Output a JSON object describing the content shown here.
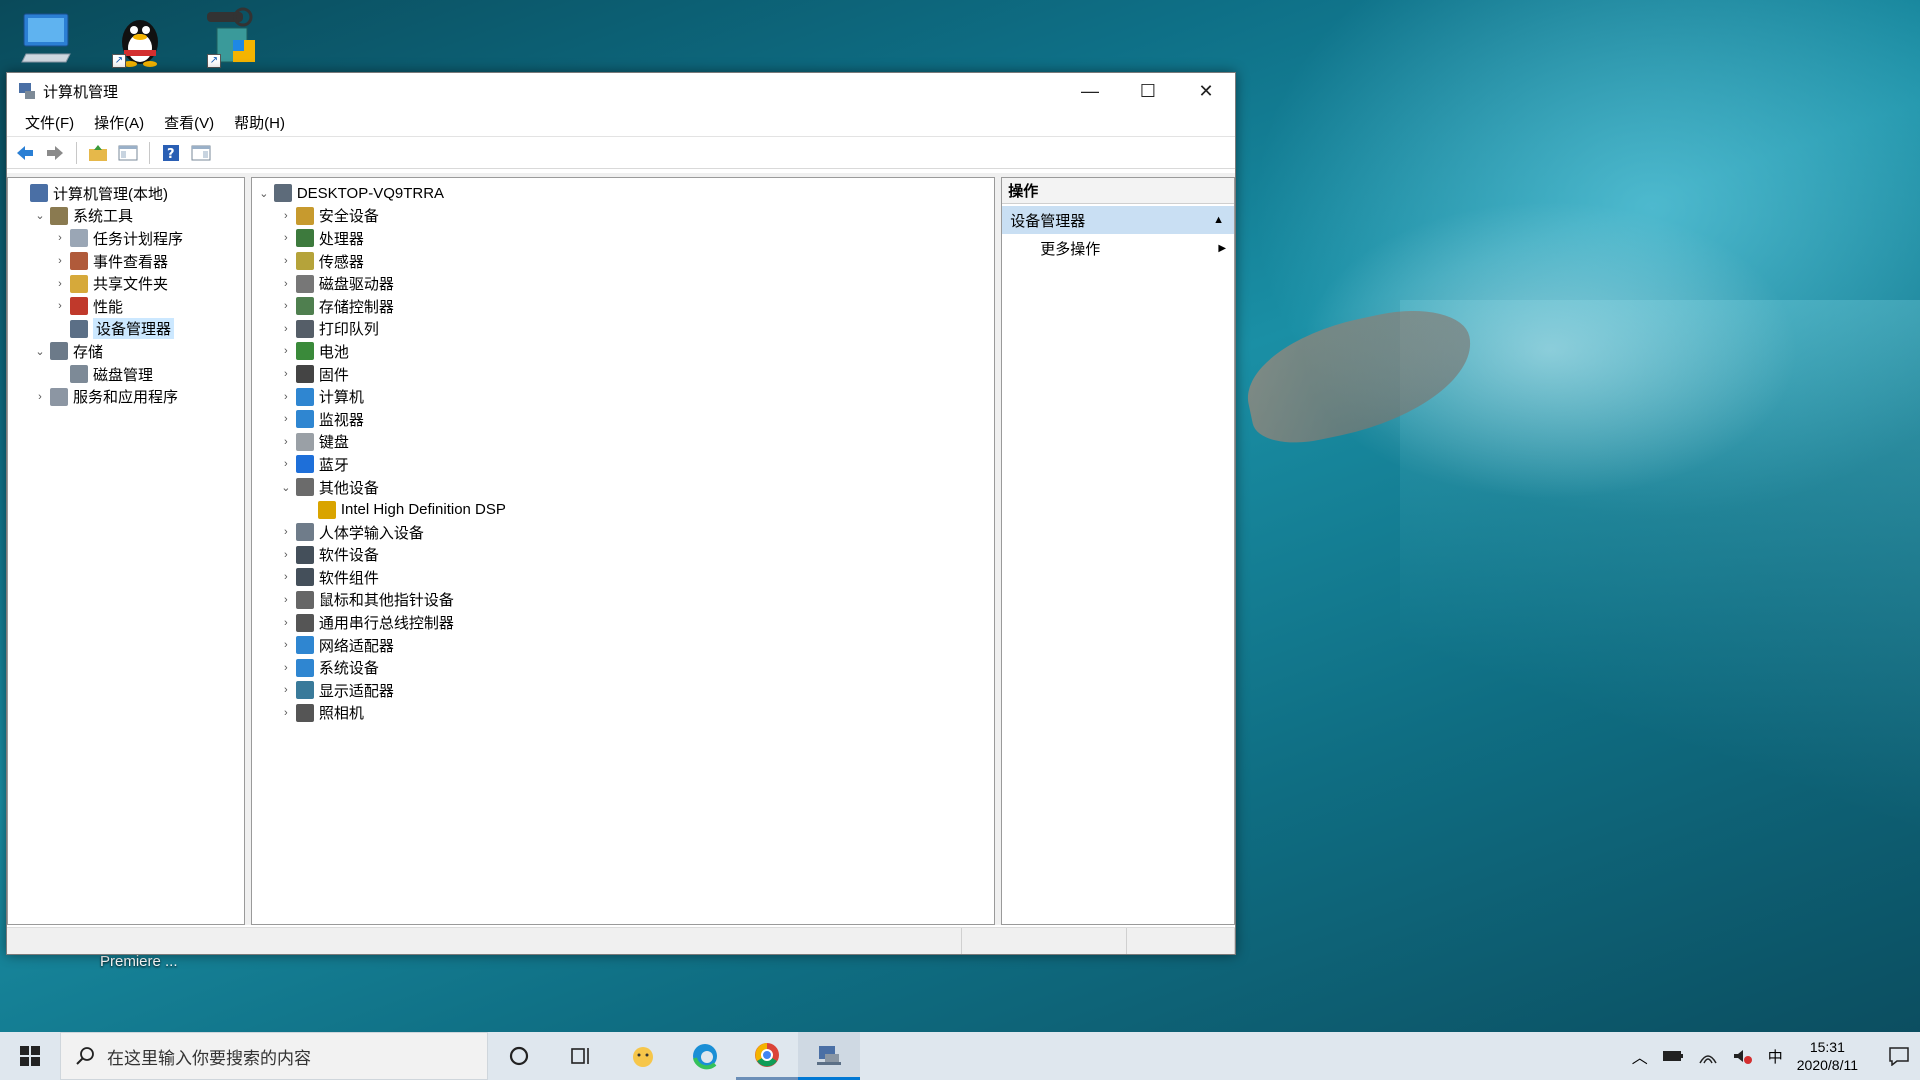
{
  "window": {
    "title": "计算机管理",
    "minimize": "—",
    "maximize": "☐",
    "close": "✕"
  },
  "menu": [
    "文件(F)",
    "操作(A)",
    "查看(V)",
    "帮助(H)"
  ],
  "left_tree": [
    {
      "label": "计算机管理(本地)",
      "level": 0,
      "twisty": "",
      "icon": "computer-management-icon",
      "color": "#4a6fa5"
    },
    {
      "label": "系统工具",
      "level": 1,
      "twisty": "⌄",
      "icon": "tools-icon",
      "color": "#8a7a50"
    },
    {
      "label": "任务计划程序",
      "level": 2,
      "twisty": "›",
      "icon": "clock-icon",
      "color": "#9aa6b5"
    },
    {
      "label": "事件查看器",
      "level": 2,
      "twisty": "›",
      "icon": "event-viewer-icon",
      "color": "#b05a3a"
    },
    {
      "label": "共享文件夹",
      "level": 2,
      "twisty": "›",
      "icon": "shared-folder-icon",
      "color": "#d6a93a"
    },
    {
      "label": "性能",
      "level": 2,
      "twisty": "›",
      "icon": "performance-icon",
      "color": "#c0392b"
    },
    {
      "label": "设备管理器",
      "level": 2,
      "twisty": "",
      "icon": "device-manager-icon",
      "color": "#5b6f86",
      "selected": true
    },
    {
      "label": "存储",
      "level": 1,
      "twisty": "⌄",
      "icon": "storage-icon",
      "color": "#6c7a89"
    },
    {
      "label": "磁盘管理",
      "level": 2,
      "twisty": "",
      "icon": "disk-icon",
      "color": "#7d8a97"
    },
    {
      "label": "服务和应用程序",
      "level": 1,
      "twisty": "›",
      "icon": "services-icon",
      "color": "#8c96a3"
    }
  ],
  "device_tree": [
    {
      "label": "DESKTOP-VQ9TRRA",
      "level": 0,
      "twisty": "⌄",
      "icon": "computer-icon",
      "color": "#5d6b7a"
    },
    {
      "label": "安全设备",
      "level": 1,
      "twisty": "›",
      "icon": "security-device-icon",
      "color": "#c79a2e"
    },
    {
      "label": "处理器",
      "level": 1,
      "twisty": "›",
      "icon": "processor-icon",
      "color": "#3d7a3d"
    },
    {
      "label": "传感器",
      "level": 1,
      "twisty": "›",
      "icon": "sensor-icon",
      "color": "#b5a33a"
    },
    {
      "label": "磁盘驱动器",
      "level": 1,
      "twisty": "›",
      "icon": "disk-drive-icon",
      "color": "#777777"
    },
    {
      "label": "存储控制器",
      "level": 1,
      "twisty": "›",
      "icon": "storage-controller-icon",
      "color": "#4f7f4f"
    },
    {
      "label": "打印队列",
      "level": 1,
      "twisty": "›",
      "icon": "printer-icon",
      "color": "#555e68"
    },
    {
      "label": "电池",
      "level": 1,
      "twisty": "›",
      "icon": "battery-icon",
      "color": "#3a8a3a"
    },
    {
      "label": "固件",
      "level": 1,
      "twisty": "›",
      "icon": "firmware-icon",
      "color": "#444444"
    },
    {
      "label": "计算机",
      "level": 1,
      "twisty": "›",
      "icon": "computer-icon",
      "color": "#2f86d1"
    },
    {
      "label": "监视器",
      "level": 1,
      "twisty": "›",
      "icon": "monitor-icon",
      "color": "#2f86d1"
    },
    {
      "label": "键盘",
      "level": 1,
      "twisty": "›",
      "icon": "keyboard-icon",
      "color": "#9aa0a6"
    },
    {
      "label": "蓝牙",
      "level": 1,
      "twisty": "›",
      "icon": "bluetooth-icon",
      "color": "#1e6fd9"
    },
    {
      "label": "其他设备",
      "level": 1,
      "twisty": "⌄",
      "icon": "unknown-device-icon",
      "color": "#6b6b6b"
    },
    {
      "label": "Intel High Definition DSP",
      "level": 2,
      "twisty": "",
      "icon": "warning-device-icon",
      "color": "#d9a400"
    },
    {
      "label": "人体学输入设备",
      "level": 1,
      "twisty": "›",
      "icon": "hid-icon",
      "color": "#6f7c8a"
    },
    {
      "label": "软件设备",
      "level": 1,
      "twisty": "›",
      "icon": "software-device-icon",
      "color": "#444f5a"
    },
    {
      "label": "软件组件",
      "level": 1,
      "twisty": "›",
      "icon": "software-component-icon",
      "color": "#444f5a"
    },
    {
      "label": "鼠标和其他指针设备",
      "level": 1,
      "twisty": "›",
      "icon": "mouse-icon",
      "color": "#666666"
    },
    {
      "label": "通用串行总线控制器",
      "level": 1,
      "twisty": "›",
      "icon": "usb-icon",
      "color": "#555555"
    },
    {
      "label": "网络适配器",
      "level": 1,
      "twisty": "›",
      "icon": "network-adapter-icon",
      "color": "#2f86d1"
    },
    {
      "label": "系统设备",
      "level": 1,
      "twisty": "›",
      "icon": "system-device-icon",
      "color": "#2f86d1"
    },
    {
      "label": "显示适配器",
      "level": 1,
      "twisty": "›",
      "icon": "display-adapter-icon",
      "color": "#3a7a9a"
    },
    {
      "label": "照相机",
      "level": 1,
      "twisty": "›",
      "icon": "camera-icon",
      "color": "#555555"
    }
  ],
  "actions": {
    "header": "操作",
    "section": "设备管理器",
    "section_arrow": "▲",
    "more": "更多操作",
    "more_arrow": "▶"
  },
  "desktop": {
    "premiere_label": "Premiere ..."
  },
  "taskbar": {
    "search_placeholder": "在这里输入你要搜索的内容",
    "ime": "中",
    "time": "15:31",
    "date": "2020/8/11"
  }
}
